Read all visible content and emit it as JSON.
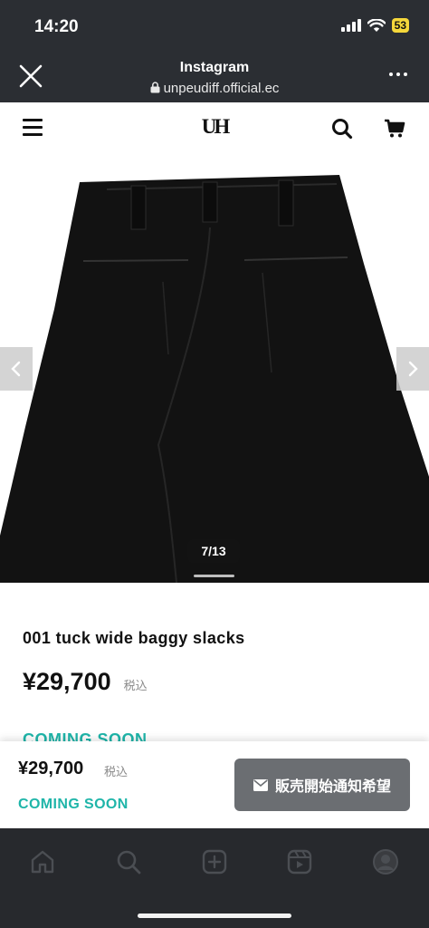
{
  "status_bar": {
    "time": "14:20",
    "battery": "53"
  },
  "browser": {
    "title": "Instagram",
    "url": "unpeudiff.official.ec"
  },
  "site": {
    "logo": "UH"
  },
  "gallery": {
    "counter": "7/13"
  },
  "product": {
    "name": "001 tuck wide baggy slacks",
    "price": "¥29,700",
    "tax_label": "税込",
    "status": "COMING SOON"
  },
  "buy_bar": {
    "price": "¥29,700",
    "tax_label": "税込",
    "status": "COMING SOON",
    "notify_label": "販売開始通知希望"
  },
  "colors": {
    "accent": "#1fb5a9",
    "button": "#6b6e72",
    "dark_bar": "#2b2e33"
  },
  "bottom_nav": {
    "icons": [
      "home-icon",
      "search-icon",
      "create-icon",
      "reels-icon",
      "profile-icon"
    ]
  }
}
